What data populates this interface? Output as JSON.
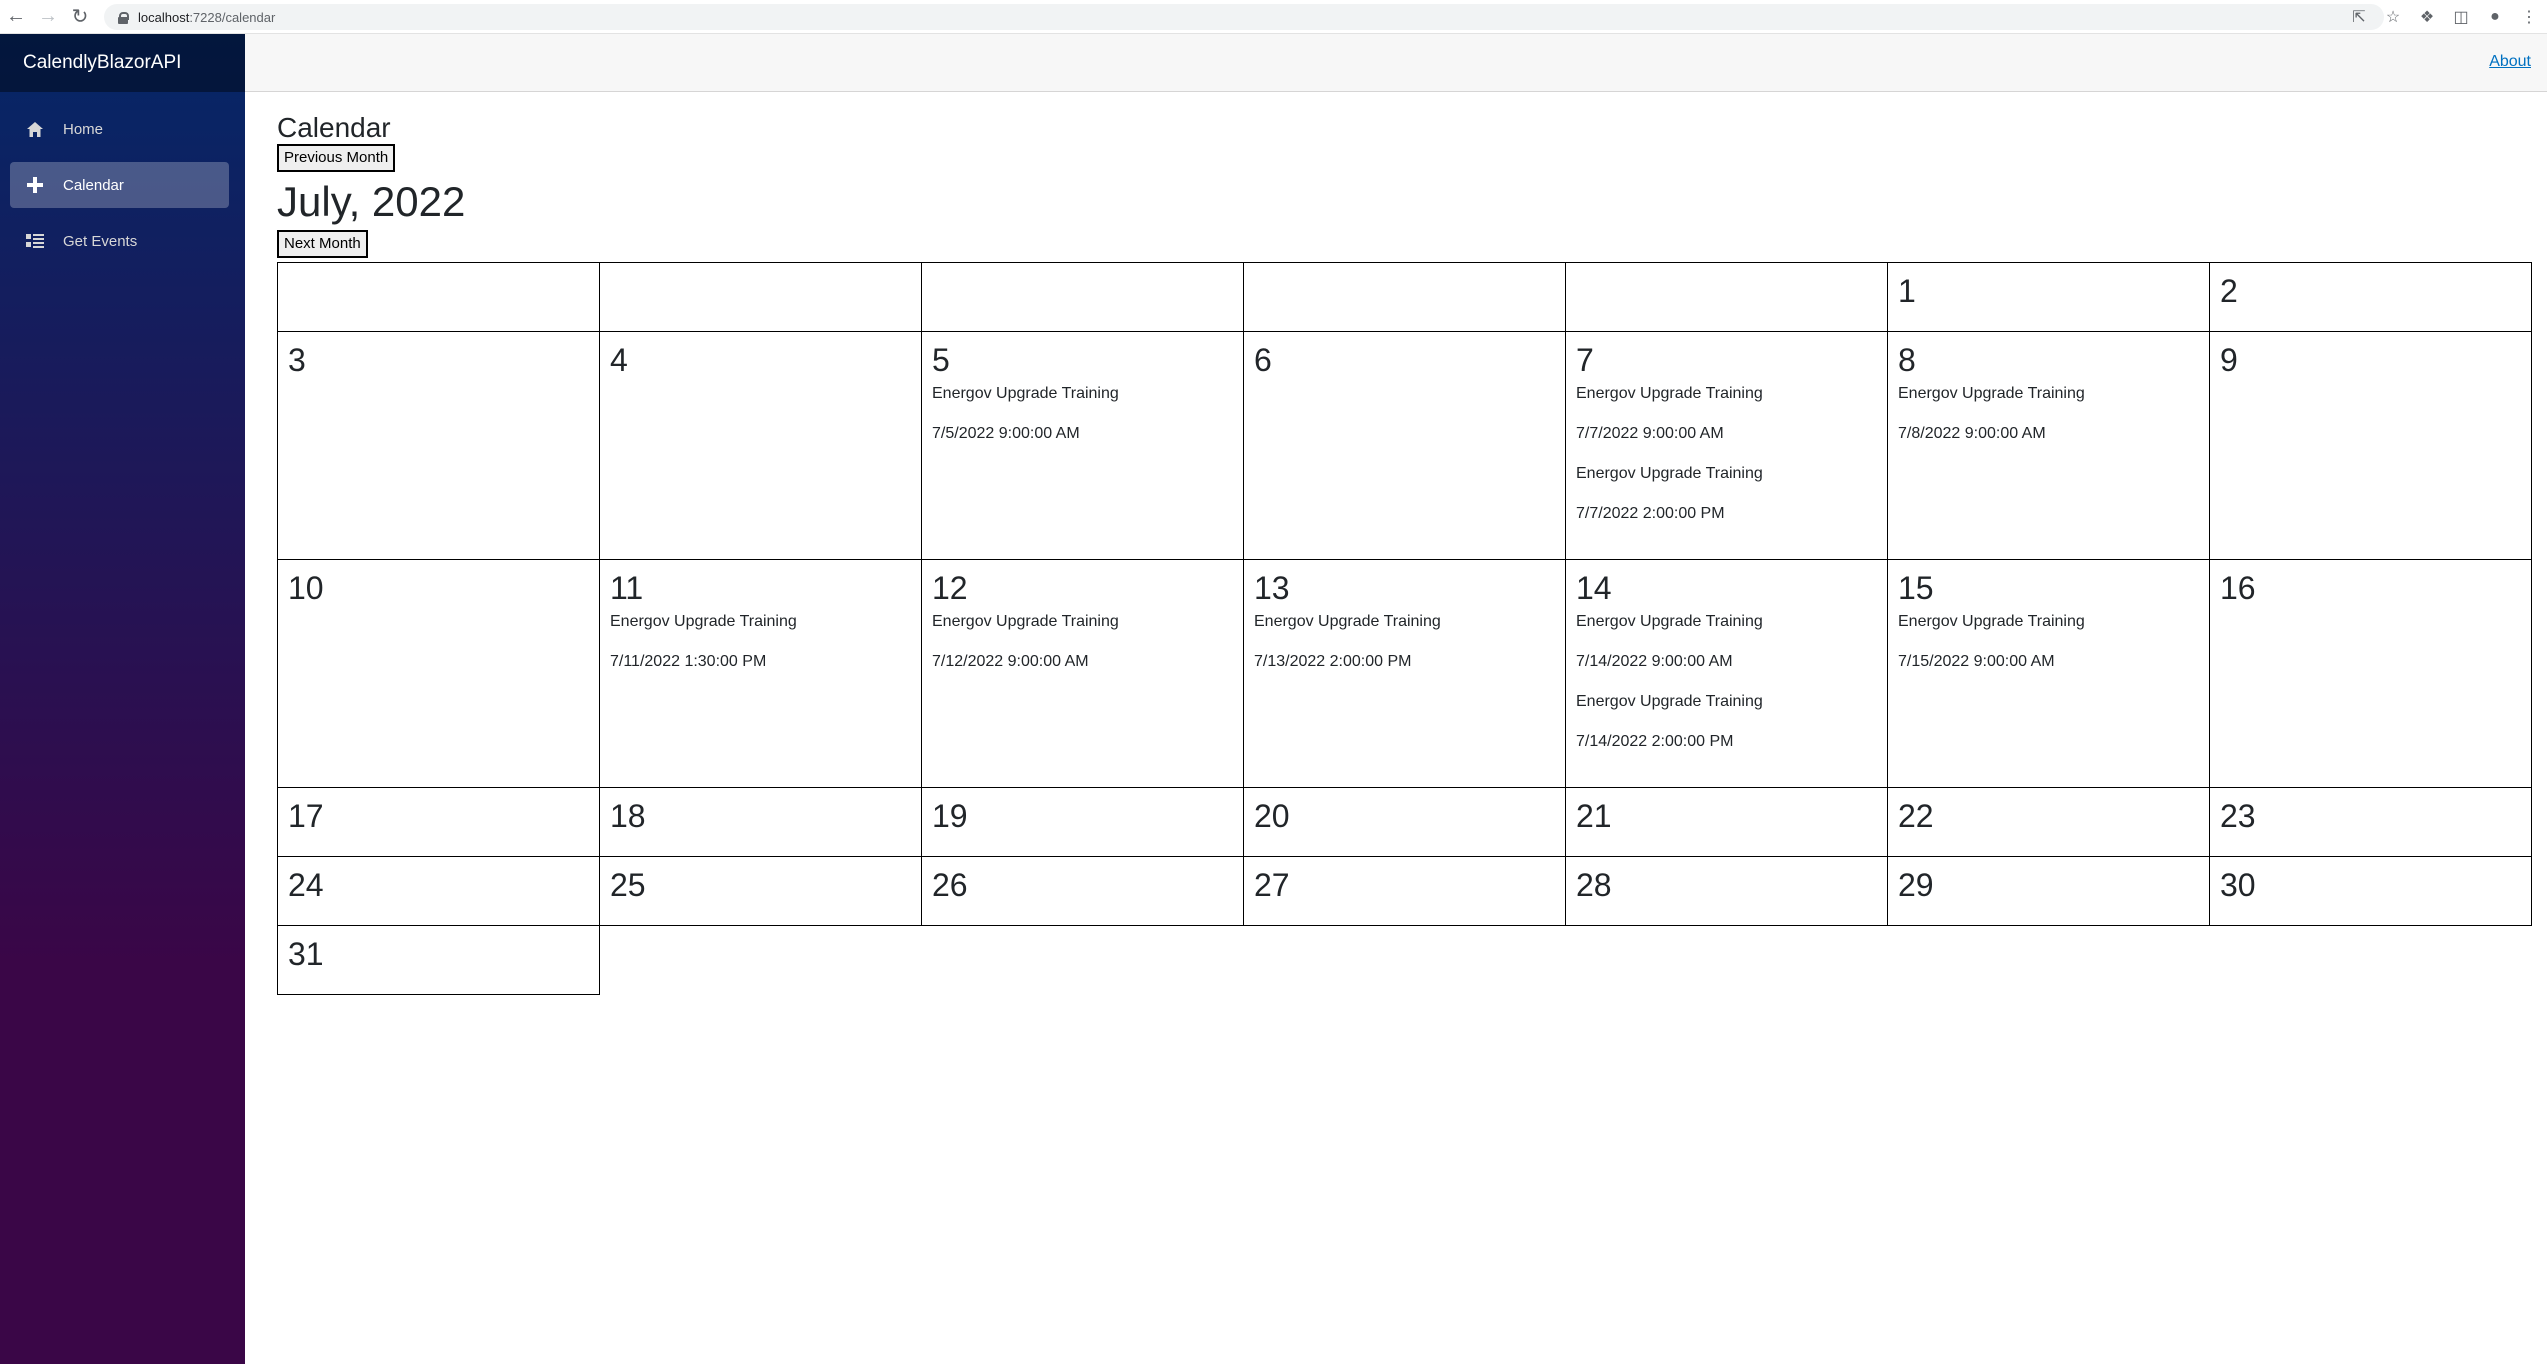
{
  "browser": {
    "url_host": "localhost",
    "url_rest": ":7228/calendar"
  },
  "sidebar": {
    "brand": "CalendlyBlazorAPI",
    "items": [
      {
        "label": "Home",
        "icon": "home-icon",
        "active": false
      },
      {
        "label": "Calendar",
        "icon": "plus-icon",
        "active": true
      },
      {
        "label": "Get Events",
        "icon": "list-icon",
        "active": false
      }
    ]
  },
  "top_row": {
    "about": "About"
  },
  "main": {
    "title": "Calendar",
    "prev_label": "Previous Month",
    "month_label": "July, 2022",
    "next_label": "Next Month"
  },
  "calendar": {
    "weeks": [
      [
        {
          "day": ""
        },
        {
          "day": ""
        },
        {
          "day": ""
        },
        {
          "day": ""
        },
        {
          "day": ""
        },
        {
          "day": "1"
        },
        {
          "day": "2"
        }
      ],
      [
        {
          "day": "3"
        },
        {
          "day": "4"
        },
        {
          "day": "5",
          "events": [
            {
              "title": "Energov Upgrade Training",
              "time": "7/5/2022 9:00:00 AM"
            }
          ]
        },
        {
          "day": "6"
        },
        {
          "day": "7",
          "events": [
            {
              "title": "Energov Upgrade Training",
              "time": "7/7/2022 9:00:00 AM"
            },
            {
              "title": "Energov Upgrade Training",
              "time": "7/7/2022 2:00:00 PM"
            }
          ]
        },
        {
          "day": "8",
          "events": [
            {
              "title": "Energov Upgrade Training",
              "time": "7/8/2022 9:00:00 AM"
            }
          ]
        },
        {
          "day": "9"
        }
      ],
      [
        {
          "day": "10"
        },
        {
          "day": "11",
          "events": [
            {
              "title": "Energov Upgrade Training",
              "time": "7/11/2022 1:30:00 PM"
            }
          ]
        },
        {
          "day": "12",
          "events": [
            {
              "title": "Energov Upgrade Training",
              "time": "7/12/2022 9:00:00 AM"
            }
          ]
        },
        {
          "day": "13",
          "events": [
            {
              "title": "Energov Upgrade Training",
              "time": "7/13/2022 2:00:00 PM"
            }
          ]
        },
        {
          "day": "14",
          "events": [
            {
              "title": "Energov Upgrade Training",
              "time": "7/14/2022 9:00:00 AM"
            },
            {
              "title": "Energov Upgrade Training",
              "time": "7/14/2022 2:00:00 PM"
            }
          ]
        },
        {
          "day": "15",
          "events": [
            {
              "title": "Energov Upgrade Training",
              "time": "7/15/2022 9:00:00 AM"
            }
          ]
        },
        {
          "day": "16"
        }
      ],
      [
        {
          "day": "17"
        },
        {
          "day": "18"
        },
        {
          "day": "19"
        },
        {
          "day": "20"
        },
        {
          "day": "21"
        },
        {
          "day": "22"
        },
        {
          "day": "23"
        }
      ],
      [
        {
          "day": "24"
        },
        {
          "day": "25"
        },
        {
          "day": "26"
        },
        {
          "day": "27"
        },
        {
          "day": "28"
        },
        {
          "day": "29"
        },
        {
          "day": "30"
        }
      ],
      [
        {
          "day": "31"
        }
      ]
    ]
  }
}
